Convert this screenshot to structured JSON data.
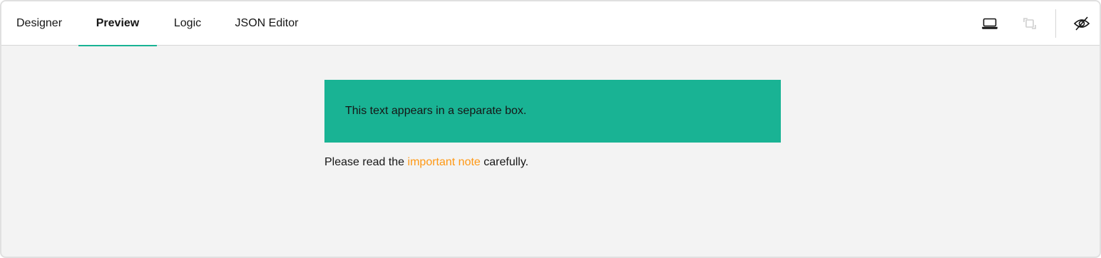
{
  "tabs": [
    {
      "label": "Designer",
      "active": false
    },
    {
      "label": "Preview",
      "active": true
    },
    {
      "label": "Logic",
      "active": false
    },
    {
      "label": "JSON Editor",
      "active": false
    }
  ],
  "toolbar": {
    "icons": [
      "laptop-icon",
      "orientation-icon",
      "eye-off-icon"
    ]
  },
  "colors": {
    "accent": "#19b394",
    "link": "#ff9814"
  },
  "content": {
    "panel_text": "This text appears in a separate box.",
    "note_prefix": "Please read the ",
    "note_link": "important note",
    "note_suffix": " carefully."
  }
}
